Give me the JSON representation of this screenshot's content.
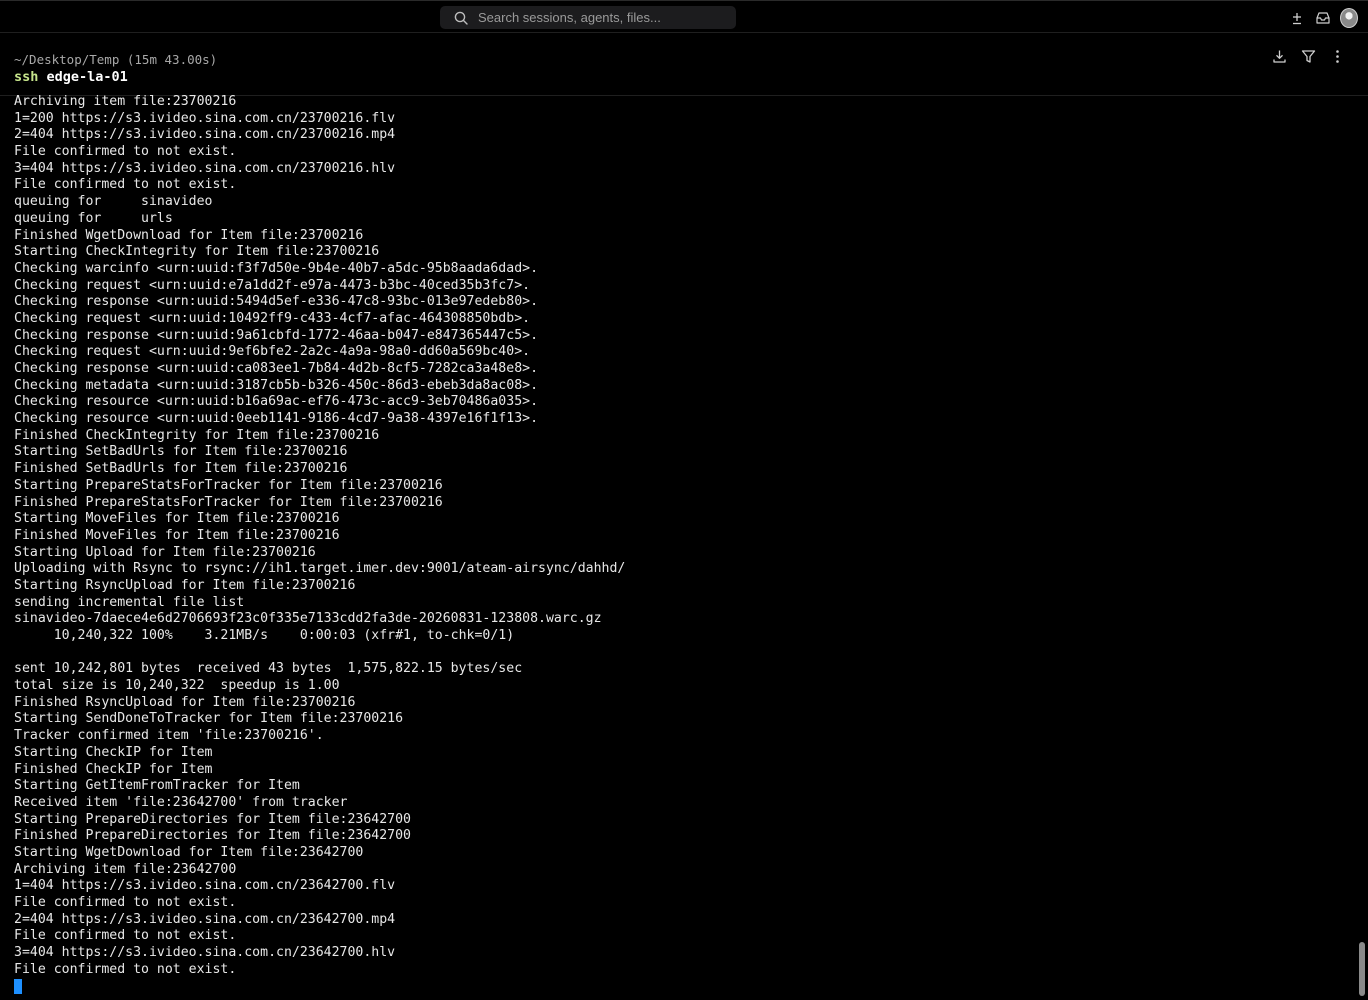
{
  "search": {
    "placeholder": "Search sessions, agents, files..."
  },
  "session": {
    "path": "~/Desktop/Temp (15m 43.00s)",
    "command_keyword": "ssh",
    "command_arg": " edge-la-01"
  },
  "icons": {
    "search": "search-icon",
    "new": "plus-icon",
    "inbox": "inbox-icon",
    "avatar": "avatar",
    "download": "download-icon",
    "filter": "filter-icon",
    "more": "more-vertical-icon"
  },
  "colors": {
    "background": "#000000",
    "text": "#e8e8e8",
    "command_keyword": "#c6e48b",
    "cursor": "#1e90ff"
  },
  "terminal": {
    "lines": [
      "Archiving item file:23700216",
      "1=200 https://s3.ivideo.sina.com.cn/23700216.flv",
      "2=404 https://s3.ivideo.sina.com.cn/23700216.mp4",
      "File confirmed to not exist.",
      "3=404 https://s3.ivideo.sina.com.cn/23700216.hlv",
      "File confirmed to not exist.",
      "queuing for     sinavideo",
      "queuing for     urls",
      "Finished WgetDownload for Item file:23700216",
      "Starting CheckIntegrity for Item file:23700216",
      "Checking warcinfo <urn:uuid:f3f7d50e-9b4e-40b7-a5dc-95b8aada6dad>.",
      "Checking request <urn:uuid:e7a1dd2f-e97a-4473-b3bc-40ced35b3fc7>.",
      "Checking response <urn:uuid:5494d5ef-e336-47c8-93bc-013e97edeb80>.",
      "Checking request <urn:uuid:10492ff9-c433-4cf7-afac-464308850bdb>.",
      "Checking response <urn:uuid:9a61cbfd-1772-46aa-b047-e847365447c5>.",
      "Checking request <urn:uuid:9ef6bfe2-2a2c-4a9a-98a0-dd60a569bc40>.",
      "Checking response <urn:uuid:ca083ee1-7b84-4d2b-8cf5-7282ca3a48e8>.",
      "Checking metadata <urn:uuid:3187cb5b-b326-450c-86d3-ebeb3da8ac08>.",
      "Checking resource <urn:uuid:b16a69ac-ef76-473c-acc9-3eb70486a035>.",
      "Checking resource <urn:uuid:0eeb1141-9186-4cd7-9a38-4397e16f1f13>.",
      "Finished CheckIntegrity for Item file:23700216",
      "Starting SetBadUrls for Item file:23700216",
      "Finished SetBadUrls for Item file:23700216",
      "Starting PrepareStatsForTracker for Item file:23700216",
      "Finished PrepareStatsForTracker for Item file:23700216",
      "Starting MoveFiles for Item file:23700216",
      "Finished MoveFiles for Item file:23700216",
      "Starting Upload for Item file:23700216",
      "Uploading with Rsync to rsync://ih1.target.imer.dev:9001/ateam-airsync/dahhd/",
      "Starting RsyncUpload for Item file:23700216",
      "sending incremental file list",
      "sinavideo-7daece4e6d2706693f23c0f335e7133cdd2fa3de-20260831-123808.warc.gz",
      "     10,240,322 100%    3.21MB/s    0:00:03 (xfr#1, to-chk=0/1)",
      "",
      "sent 10,242,801 bytes  received 43 bytes  1,575,822.15 bytes/sec",
      "total size is 10,240,322  speedup is 1.00",
      "Finished RsyncUpload for Item file:23700216",
      "Starting SendDoneToTracker for Item file:23700216",
      "Tracker confirmed item 'file:23700216'.",
      "Starting CheckIP for Item",
      "Finished CheckIP for Item",
      "Starting GetItemFromTracker for Item",
      "Received item 'file:23642700' from tracker",
      "Starting PrepareDirectories for Item file:23642700",
      "Finished PrepareDirectories for Item file:23642700",
      "Starting WgetDownload for Item file:23642700",
      "Archiving item file:23642700",
      "1=404 https://s3.ivideo.sina.com.cn/23642700.flv",
      "File confirmed to not exist.",
      "2=404 https://s3.ivideo.sina.com.cn/23642700.mp4",
      "File confirmed to not exist.",
      "3=404 https://s3.ivideo.sina.com.cn/23642700.hlv",
      "File confirmed to not exist."
    ]
  }
}
